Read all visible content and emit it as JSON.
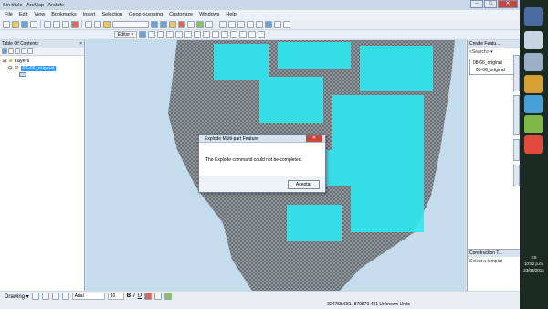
{
  "window": {
    "title": "Sin título - ArcMap - ArcInfo",
    "min": "–",
    "max": "□",
    "close": "✕"
  },
  "menu": [
    "File",
    "Edit",
    "View",
    "Bookmarks",
    "Insert",
    "Selection",
    "Geoprocessing",
    "Customize",
    "Windows",
    "Help"
  ],
  "toolbar": {
    "editor_label": "Editor ▾"
  },
  "toc": {
    "title": "Table Of Contents",
    "close": "× ",
    "group": "Layers",
    "layer": "08-66_original"
  },
  "right_pane": {
    "title": "Create Featu...",
    "search": "<Search> ▾",
    "items": [
      "08-66_original",
      "08-66_original"
    ],
    "construction_title": "Construction T...",
    "construction_hint": "Select a templat"
  },
  "dialog": {
    "title": "Explode Multi-part Feature",
    "message": "The Explode command could not be completed.",
    "button": "Aceptar",
    "close": "✕"
  },
  "drawbar": {
    "drawing": "Drawing ▾",
    "font": "Arial",
    "size": "10",
    "bold": "B",
    "italic": "I",
    "underline": "U"
  },
  "status": {
    "coords": "324755.681  -870870.481 Unknown Units"
  },
  "tray": {
    "lang": "ES",
    "time": "10:52 p.m.",
    "date": "23/03/2014"
  },
  "vertical_tabs": [
    "ArcToolbox",
    "Image Analysis",
    "Catalog",
    "Search"
  ]
}
